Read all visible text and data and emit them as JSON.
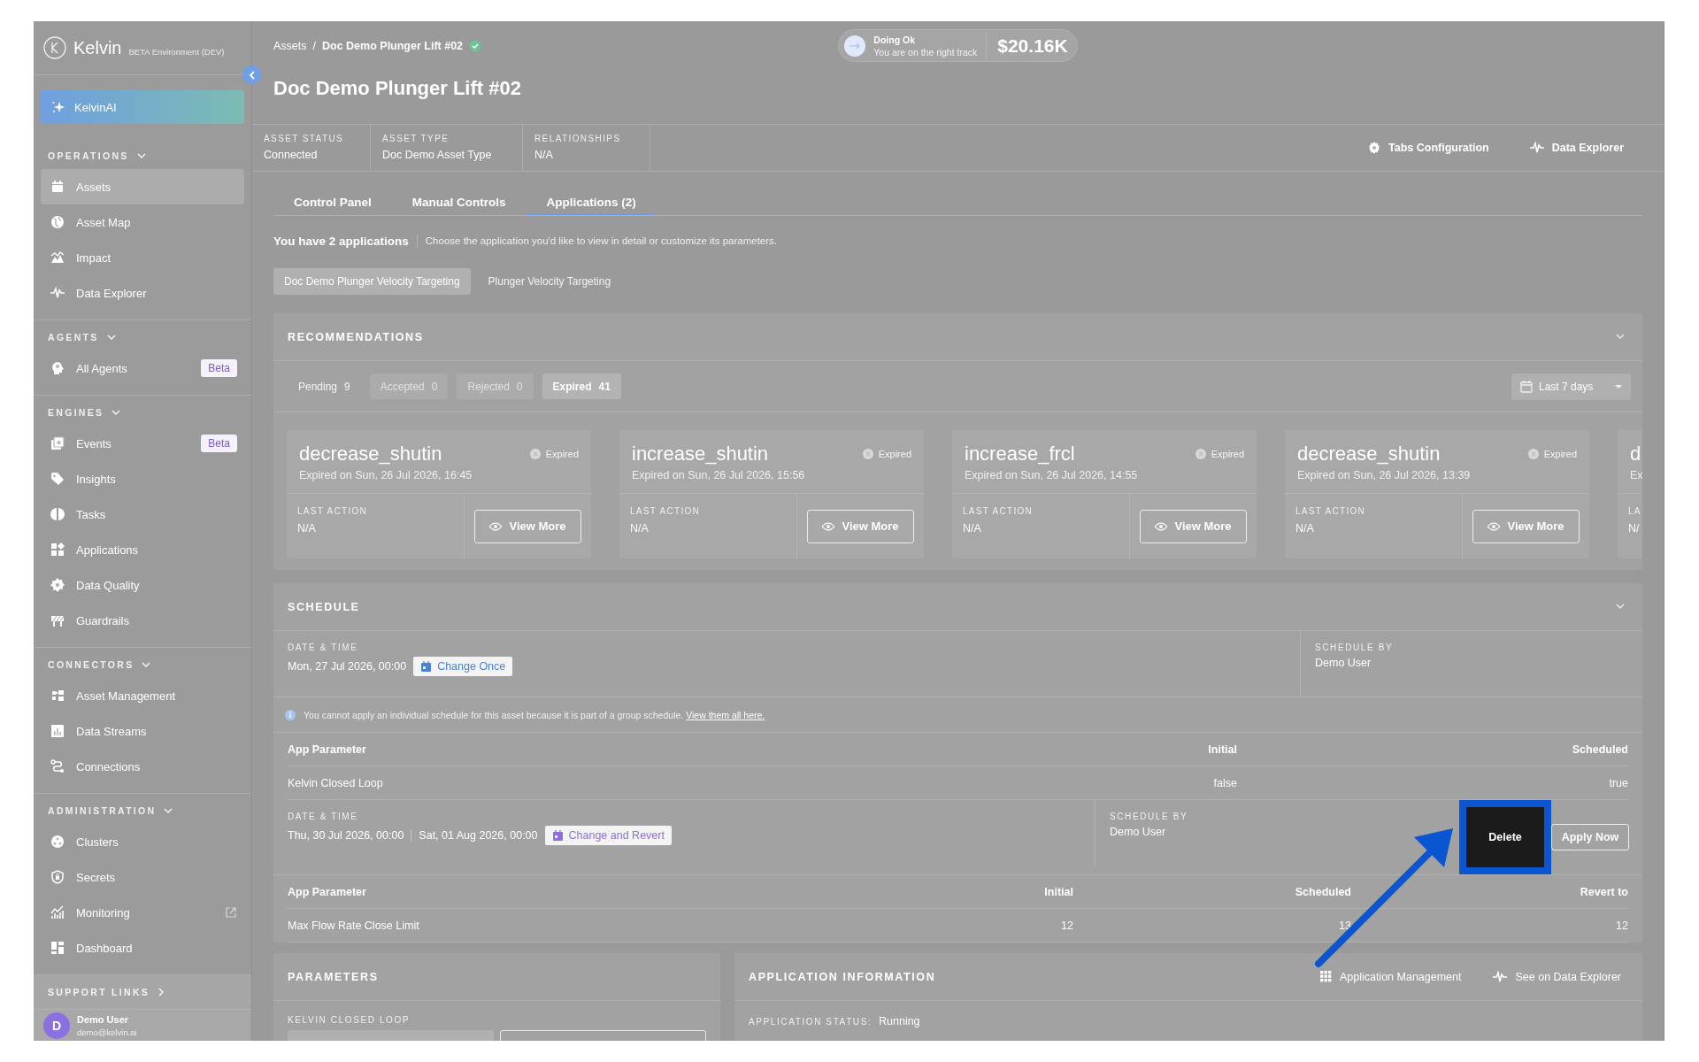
{
  "sidebar": {
    "logo": "Kelvin",
    "environment": "BETA Environment (DEV)",
    "assistant": "KelvinAI",
    "sections": [
      {
        "title": "OPERATIONS",
        "expanded": true,
        "items": [
          {
            "label": "Assets",
            "selected": true,
            "external": false
          },
          {
            "label": "Asset Map",
            "selected": false,
            "external": false
          },
          {
            "label": "Impact",
            "selected": false,
            "external": false
          },
          {
            "label": "Data Explorer",
            "selected": false,
            "external": false
          }
        ]
      },
      {
        "title": "AGENTS",
        "expanded": true,
        "items": [
          {
            "label": "All Agents",
            "selected": false,
            "external": false,
            "badge": "Beta"
          }
        ]
      },
      {
        "title": "ENGINES",
        "expanded": true,
        "items": [
          {
            "label": "Events",
            "selected": false,
            "external": false,
            "badge": "Beta"
          },
          {
            "label": "Insights",
            "selected": false,
            "external": false
          },
          {
            "label": "Tasks",
            "selected": false,
            "external": false
          },
          {
            "label": "Applications",
            "selected": false,
            "external": false
          },
          {
            "label": "Data Quality",
            "selected": false,
            "external": false
          },
          {
            "label": "Guardrails",
            "selected": false,
            "external": false
          }
        ]
      },
      {
        "title": "CONNECTORS",
        "expanded": true,
        "items": [
          {
            "label": "Asset Management",
            "selected": false,
            "external": false
          },
          {
            "label": "Data Streams",
            "selected": false,
            "external": false
          },
          {
            "label": "Connections",
            "selected": false,
            "external": false
          }
        ]
      },
      {
        "title": "ADMINISTRATION",
        "expanded": true,
        "items": [
          {
            "label": "Clusters",
            "selected": false,
            "external": false
          },
          {
            "label": "Secrets",
            "selected": false,
            "external": false
          },
          {
            "label": "Monitoring",
            "selected": false,
            "external": true
          },
          {
            "label": "Dashboard",
            "selected": false,
            "external": false
          }
        ]
      }
    ],
    "support_links": {
      "title": "SUPPORT LINKS",
      "expanded": false
    },
    "user": {
      "initial": "D",
      "name": "Demo User",
      "email": "demo@kelvin.ai"
    }
  },
  "breadcrumb": {
    "items": [
      "Assets",
      "Doc Demo Plunger Lift #02"
    ],
    "separator": "/",
    "verified": true
  },
  "status": {
    "title": "Doing Ok",
    "subtitle": "You are on the right track",
    "value": "$20.16K"
  },
  "title": "Doc Demo Plunger Lift #02",
  "properties": [
    {
      "label": "ASSET STATUS",
      "value": "Connected"
    },
    {
      "label": "ASSET TYPE",
      "value": "Doc Demo Asset Type"
    },
    {
      "label": "RELATIONSHIPS",
      "value": "N/A"
    }
  ],
  "actions": [
    "Tabs Configuration",
    "Data Explorer"
  ],
  "tabs": [
    {
      "label": "Control Panel",
      "selected": false
    },
    {
      "label": "Manual Controls",
      "selected": false
    },
    {
      "label": "Applications (2)",
      "selected": true
    }
  ],
  "applications": {
    "summary": "You have 2 applications",
    "hint": "Choose the application you'd like to view in detail or customize its parameters.",
    "items": [
      {
        "label": "Doc Demo Plunger Velocity Targeting",
        "selected": true
      },
      {
        "label": "Plunger Velocity Targeting",
        "selected": false
      }
    ]
  },
  "recommendations": {
    "title": "RECOMMENDATIONS",
    "expanded": true,
    "filters": [
      {
        "label": "Pending",
        "count": "9",
        "selected": false,
        "disabled": false
      },
      {
        "label": "Accepted",
        "count": "0",
        "selected": false,
        "disabled": true
      },
      {
        "label": "Rejected",
        "count": "0",
        "selected": false,
        "disabled": true
      },
      {
        "label": "Expired",
        "count": "41",
        "selected": true,
        "disabled": false
      }
    ],
    "range": "Last 7 days",
    "cards": [
      {
        "title": "decrease_shutin",
        "status": "Expired",
        "expired": "Expired on Sun, 26 Jul 2026, 16:45",
        "last_action_label": "LAST ACTION",
        "last_action": "N/A",
        "button": "View More"
      },
      {
        "title": "increase_shutin",
        "status": "Expired",
        "expired": "Expired on Sun, 26 Jul 2026, 15:56",
        "last_action_label": "LAST ACTION",
        "last_action": "N/A",
        "button": "View More"
      },
      {
        "title": "increase_frcl",
        "status": "Expired",
        "expired": "Expired on Sun, 26 Jul 2026, 14:55",
        "last_action_label": "LAST ACTION",
        "last_action": "N/A",
        "button": "View More"
      },
      {
        "title": "decrease_shutin",
        "status": "Expired",
        "expired": "Expired on Sun, 26 Jul 2026, 13:39",
        "last_action_label": "LAST ACTION",
        "last_action": "N/A",
        "button": "View More"
      },
      {
        "title": "d",
        "expired": "Ex",
        "last_action_label": "LA",
        "last_action": "N/"
      }
    ]
  },
  "schedule": {
    "title": "SCHEDULE",
    "expanded": true,
    "blocks": [
      {
        "date_label": "DATE & TIME",
        "dates": [
          "Mon, 27 Jul 2026, 00:00"
        ],
        "action": "Change Once",
        "color": "#4a82d6",
        "by_label": "SCHEDULE BY",
        "by": "Demo User",
        "notice": {
          "text": "You cannot apply an individual schedule for this asset because it is part of a group schedule.",
          "link": "View them all here."
        },
        "columns": [
          "App Parameter",
          "Initial",
          "Scheduled"
        ],
        "rows": [
          [
            "Kelvin Closed Loop",
            "false",
            "true"
          ]
        ]
      },
      {
        "date_label": "DATE & TIME",
        "dates": [
          "Thu, 30 Jul 2026, 00:00",
          "Sat, 01 Aug 2026, 00:00"
        ],
        "action": "Change and Revert",
        "color": "#8e6fdb",
        "by_label": "SCHEDULE BY",
        "by": "Demo User",
        "buttons": [
          {
            "label": "Delete",
            "highlighted": true
          },
          {
            "label": "Apply Now",
            "highlighted": false
          }
        ],
        "columns": [
          "App Parameter",
          "Initial",
          "Scheduled",
          "Revert to"
        ],
        "rows": [
          [
            "Max Flow Rate Close Limit",
            "12",
            "13",
            "12"
          ]
        ]
      }
    ]
  },
  "parameters": {
    "title": "PARAMETERS",
    "fields": [
      {
        "label": "KELVIN CLOSED LOOP"
      }
    ]
  },
  "application_info": {
    "title": "APPLICATION INFORMATION",
    "links": [
      "Application Management",
      "See on Data Explorer"
    ],
    "fields": [
      {
        "label": "APPLICATION STATUS:",
        "value": "Running"
      }
    ]
  }
}
